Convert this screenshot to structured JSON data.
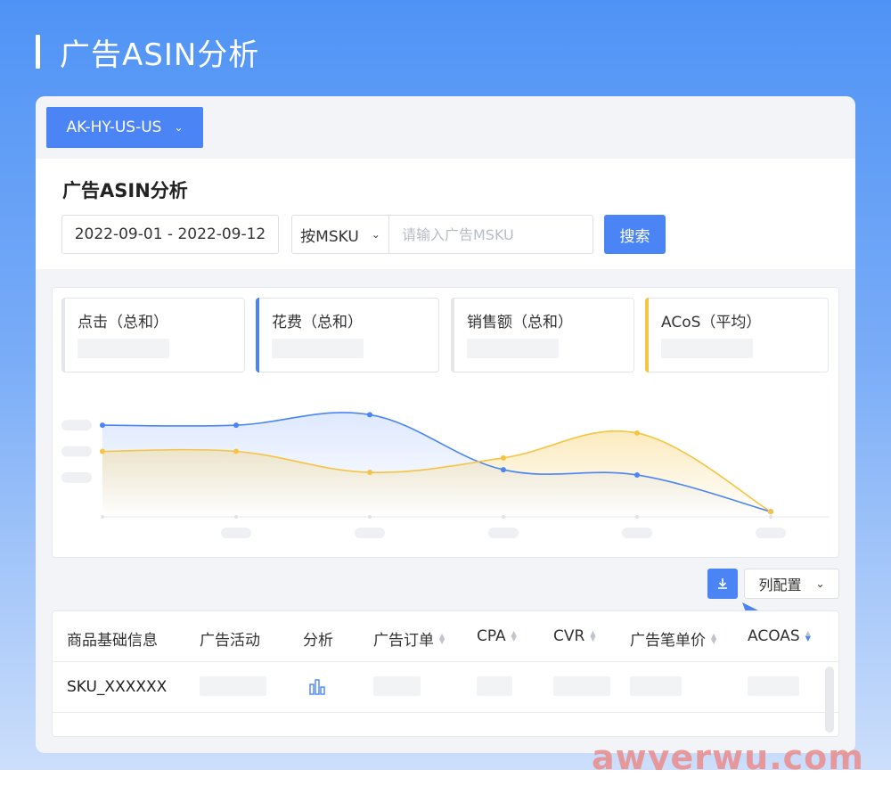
{
  "page": {
    "title": "广告ASIN分析"
  },
  "account": {
    "selected": "AK-HY-US-US"
  },
  "filters": {
    "section_title": "广告ASIN分析",
    "date_range": "2022-09-01 - 2022-09-12",
    "mode_selected": "按MSKU",
    "msku_placeholder": "请输入广告MSKU",
    "search_label": "搜索"
  },
  "metrics": [
    {
      "label": "点击（总和）",
      "accent": "#e5e6eb"
    },
    {
      "label": "花费（总和）",
      "accent": "#4a84f5"
    },
    {
      "label": "销售额（总和）",
      "accent": "#e5e6eb"
    },
    {
      "label": "ACoS（平均）",
      "accent": "#f5c443"
    }
  ],
  "chart_data": {
    "type": "line",
    "x": [
      1,
      2,
      3,
      4,
      5,
      6
    ],
    "series": [
      {
        "values": [
          0.7,
          0.7,
          0.78,
          0.36,
          0.32,
          0.04
        ],
        "color": "#4a84f5"
      },
      {
        "values": [
          0.5,
          0.5,
          0.34,
          0.45,
          0.64,
          0.04
        ],
        "color": "#f5c443"
      }
    ],
    "ylim": [
      0,
      1
    ],
    "grid": false
  },
  "toolbar": {
    "column_config_label": "列配置"
  },
  "table": {
    "columns": [
      "商品基础信息",
      "广告活动",
      "分析",
      "广告订单",
      "CPA",
      "CVR",
      "广告笔单价",
      "ACOAS"
    ],
    "rows": [
      {
        "sku": "SKU_XXXXXX"
      }
    ]
  },
  "watermark": "awyerwu.com",
  "colors": {
    "primary": "#4a84f5",
    "acos": "#f5c443"
  }
}
